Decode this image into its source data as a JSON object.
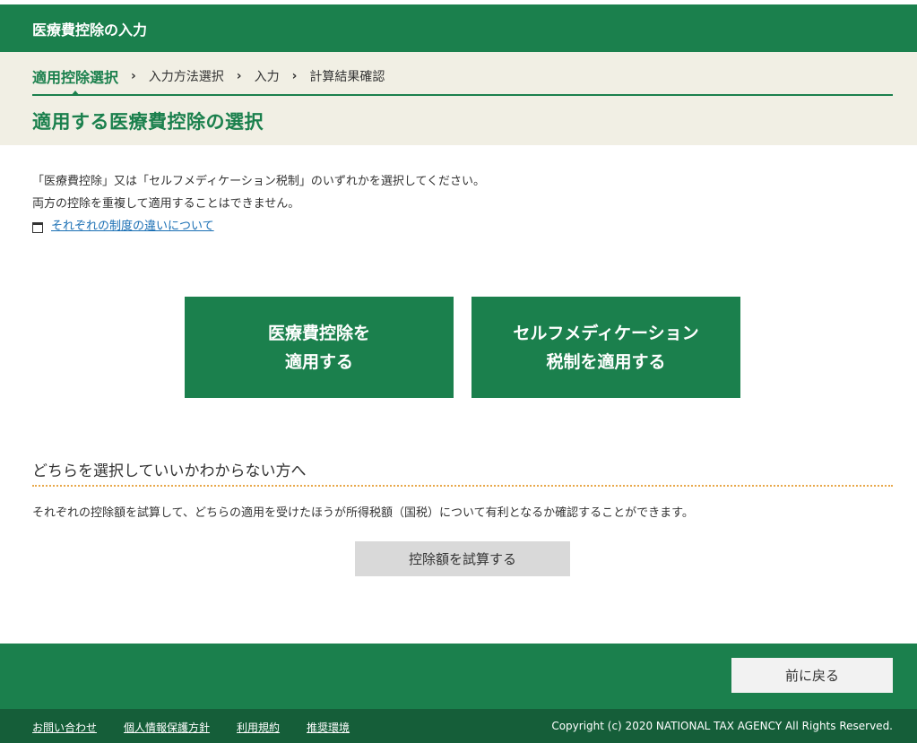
{
  "header": {
    "title": "医療費控除の入力"
  },
  "steps": [
    {
      "label": "適用控除選択",
      "active": true
    },
    {
      "label": "入力方法選択",
      "active": false
    },
    {
      "label": "入力",
      "active": false
    },
    {
      "label": "計算結果確認",
      "active": false
    }
  ],
  "step_separator": "›",
  "page_title": "適用する医療費控除の選択",
  "intro": {
    "line1": "「医療費控除」又は「セルフメディケーション税制」のいずれかを選択してください。",
    "line2": "両方の控除を重複して適用することはできません。",
    "link_label": "それぞれの制度の違いについて"
  },
  "choices": {
    "medical": {
      "line1": "医療費控除を",
      "line2": "適用する"
    },
    "self_medication": {
      "line1": "セルフメディケーション",
      "line2": "税制を適用する"
    }
  },
  "help": {
    "heading": "どちらを選択していいかわからない方へ",
    "text": "それぞれの控除額を試算して、どちらの適用を受けたほうが所得税額（国税）について有利となるか確認することができます。",
    "simulate_label": "控除額を試算する"
  },
  "footer": {
    "back_label": "前に戻る",
    "links": [
      "お問い合わせ",
      "個人情報保護方針",
      "利用規約",
      "推奨環境"
    ],
    "copyright": "Copyright (c) 2020 NATIONAL TAX AGENCY All Rights Reserved."
  },
  "colors": {
    "brand_green": "#1b804d",
    "footer_dark_green": "#155e39",
    "beige": "#f1efe4",
    "link_blue": "#1a6fb4",
    "dotted_orange": "#e8a84a"
  }
}
